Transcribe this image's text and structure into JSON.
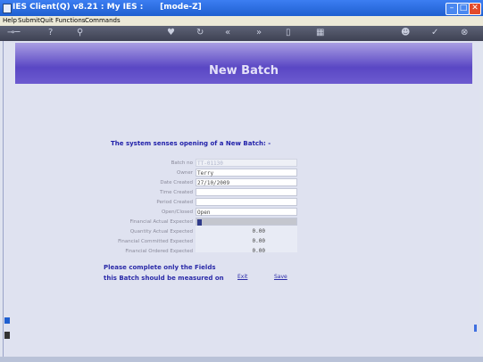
{
  "window": {
    "title": "IES Client(Q) v8.21 : My IES :      [mode-Z]",
    "buttons": {
      "minimize": "–",
      "maximize": "□",
      "close": "✕"
    }
  },
  "menu": [
    "Help",
    "Submit",
    "Quit",
    "Functions",
    "Commands"
  ],
  "header": {
    "title": "New Batch"
  },
  "intro_text": "The system senses opening of a New Batch: -",
  "form": {
    "fields": [
      {
        "label": "Batch no",
        "value": "TT-01130",
        "style": "ro"
      },
      {
        "label": "Owner",
        "value": "Terry",
        "style": "input"
      },
      {
        "label": "Date Created",
        "value": "27/10/2009",
        "style": "input"
      },
      {
        "label": "Time Created",
        "value": "",
        "style": "input"
      },
      {
        "label": "Period Created",
        "value": "",
        "style": "input"
      },
      {
        "label": "Open/Closed",
        "value": "Open",
        "style": "input"
      },
      {
        "label": "Financial Actual Expected",
        "value": "",
        "style": "sel"
      },
      {
        "label": "Quantity Actual Expected",
        "value": "0.00",
        "style": "num"
      },
      {
        "label": "Financial Committed Expected",
        "value": "0.00",
        "style": "num"
      },
      {
        "label": "Financial Ordered Expected",
        "value": "0.00",
        "style": "num"
      }
    ]
  },
  "note": {
    "line1": "Please complete only the Fields",
    "line2": "this Batch should be measured on"
  },
  "actions": {
    "exit": "Exit",
    "save": "Save"
  },
  "toolbar_icons": [
    "key-icon",
    "help-icon",
    "search-icon",
    "heart-icon",
    "refresh-icon",
    "rewind-icon",
    "forward-icon",
    "document-icon",
    "grid-icon",
    "person-icon",
    "check-icon",
    "close-icon"
  ],
  "colors": {
    "header": "#5a47c4",
    "text_blue": "#2a2aa8",
    "titlebar": "#1f5fd0"
  }
}
